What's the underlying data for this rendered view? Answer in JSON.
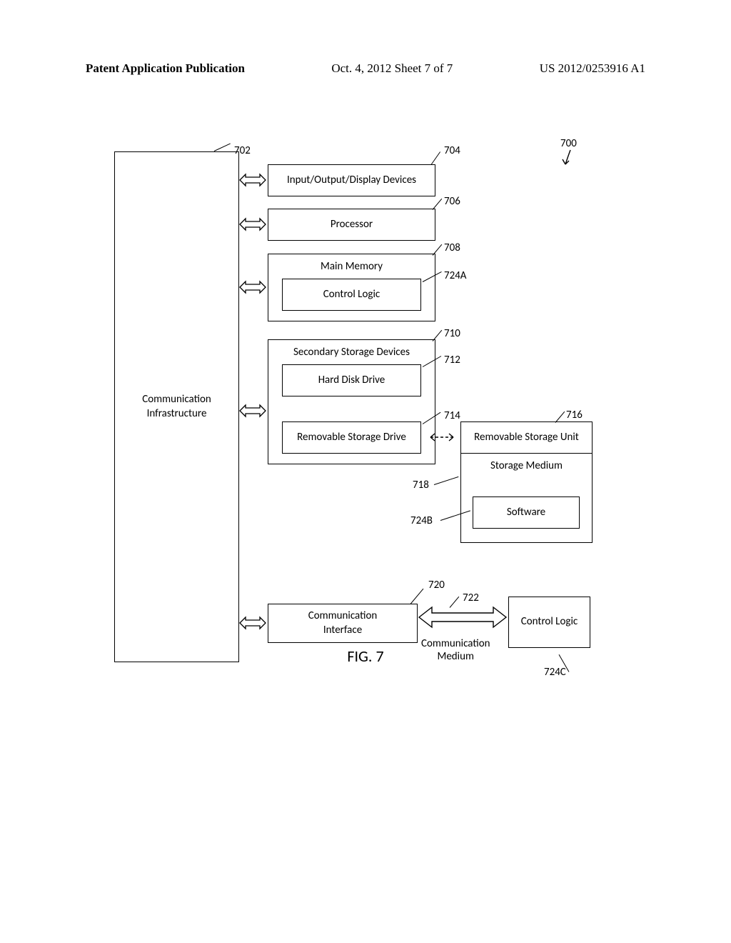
{
  "header": {
    "left": "Patent Application Publication",
    "center": "Oct. 4, 2012   Sheet 7 of 7",
    "right": "US 2012/0253916 A1"
  },
  "labels": {
    "comm_infra": "Communication\nInfrastructure",
    "io_devices": "Input/Output/Display Devices",
    "processor": "Processor",
    "main_memory": "Main Memory",
    "control_logic_a": "Control Logic",
    "secondary_storage": "Secondary Storage Devices",
    "hard_disk": "Hard Disk Drive",
    "removable_drive": "Removable Storage Drive",
    "removable_unit": "Removable Storage Unit",
    "storage_medium": "Storage Medium",
    "software": "Software",
    "comm_interface": "Communication\nInterface",
    "comm_medium": "Communication\nMedium",
    "control_logic_c": "Control Logic"
  },
  "refs": {
    "system": "700",
    "bus": "702",
    "io": "704",
    "proc": "706",
    "mem": "708",
    "ctrl_a": "724A",
    "sec": "710",
    "hdd": "712",
    "rsd": "714",
    "rsu": "716",
    "sm": "718",
    "sw": "724B",
    "ci": "720",
    "cm": "722",
    "ctrl_c": "724C"
  },
  "figure_caption": "FIG. 7"
}
